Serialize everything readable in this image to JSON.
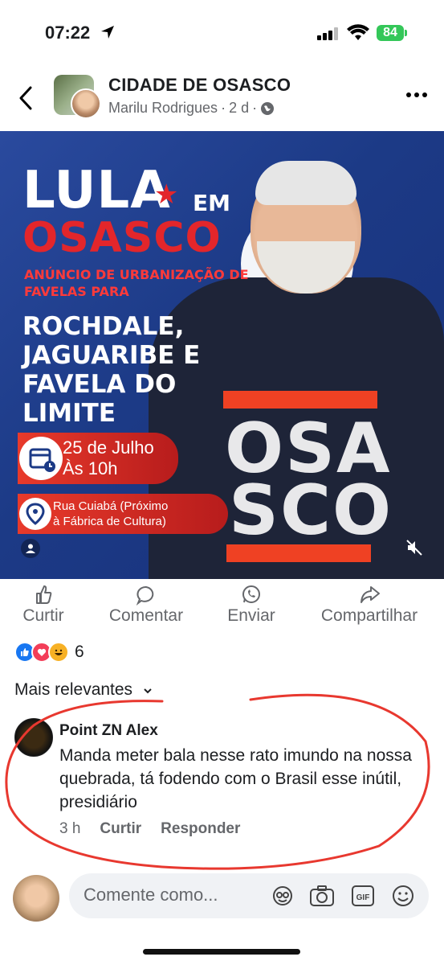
{
  "status_bar": {
    "time": "07:22",
    "battery": "84"
  },
  "header": {
    "group_name": "CIDADE DE OSASCO",
    "author": "Marilu Rodrigues",
    "age": "2 d"
  },
  "post_image": {
    "title_lula": "LULA",
    "title_em": "EM",
    "title_osasco": "OSASCO",
    "subtitle": "ANÚNCIO DE URBANIZAÇÃO DE FAVELAS PARA",
    "places": "ROCHDALE, JAGUARIBE E FAVELA DO LIMITE",
    "date_line1": "25 de Julho",
    "date_line2": "Às 10h",
    "location_line1": "Rua Cuiabá (Próximo",
    "location_line2": "à Fábrica de Cultura)",
    "shirt_line1": "OSA",
    "shirt_line2": "SCO",
    "colors": {
      "background": "#1c3a86",
      "red": "#e3262b",
      "stripe": "#ef4123"
    }
  },
  "actions": {
    "like": "Curtir",
    "comment": "Comentar",
    "send": "Enviar",
    "share": "Compartilhar"
  },
  "reactions": {
    "count": "6",
    "types": [
      "like-icon",
      "love-icon",
      "haha-icon"
    ]
  },
  "sort": {
    "label": "Mais relevantes"
  },
  "comment": {
    "author": "Point ZN Alex",
    "text": "Manda meter bala nesse rato imundo na nossa quebrada, tá fodendo com o Brasil esse inútil, presidiário",
    "time": "3 h",
    "like": "Curtir",
    "reply": "Responder"
  },
  "composer": {
    "placeholder": "Comente como..."
  }
}
